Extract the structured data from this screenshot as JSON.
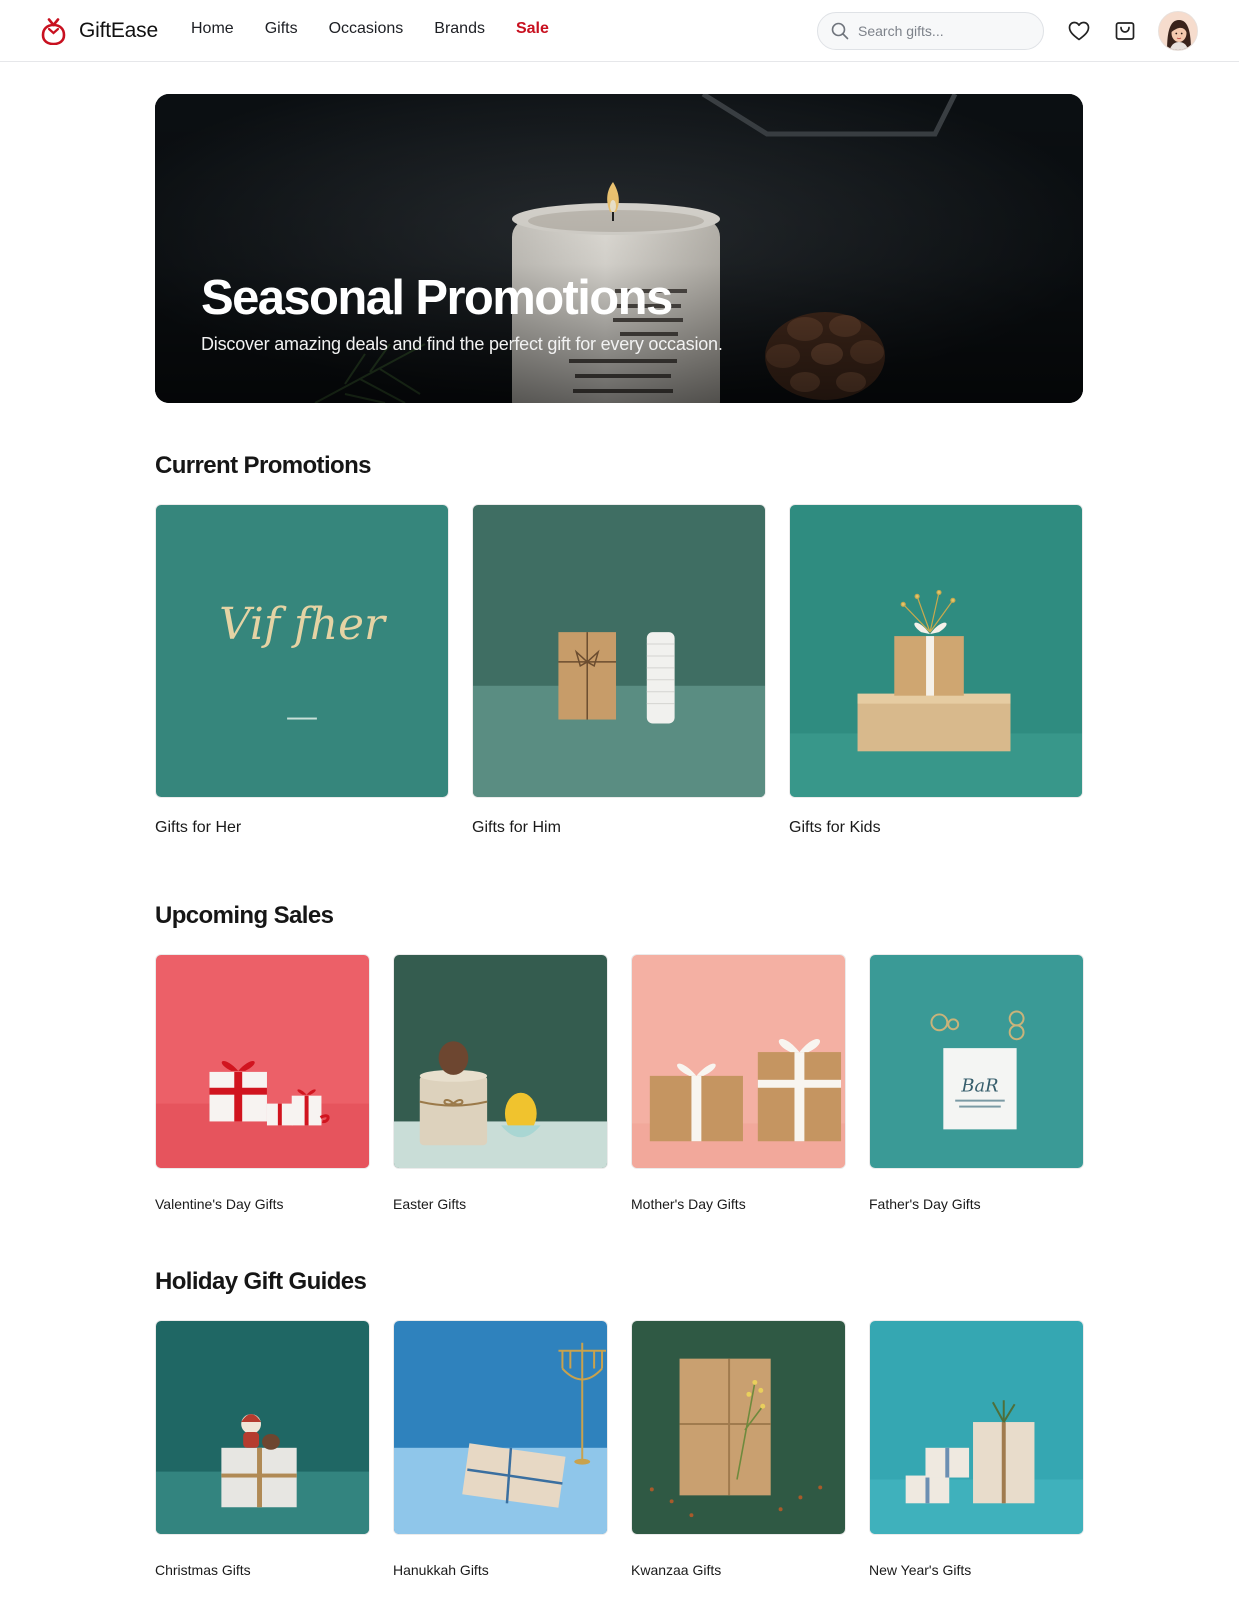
{
  "brand": {
    "name": "GiftEase",
    "logo_icon": "gift-pouch-icon",
    "accent": "#c8101f"
  },
  "nav": {
    "items": [
      {
        "label": "Home"
      },
      {
        "label": "Gifts"
      },
      {
        "label": "Occasions"
      },
      {
        "label": "Brands"
      },
      {
        "label": "Sale",
        "highlight": true
      }
    ]
  },
  "search": {
    "placeholder": "Search gifts...",
    "value": "",
    "icon": "search-icon"
  },
  "header_actions": {
    "wishlist_icon": "heart-icon",
    "cart_icon": "cart-icon",
    "avatar": "user-avatar"
  },
  "hero": {
    "title": "Seasonal Promotions",
    "subtitle": "Discover amazing deals and find the perfect gift for every occasion."
  },
  "sections": {
    "current_promotions": {
      "title": "Current Promotions",
      "cards": [
        {
          "label": "Gifts for Her",
          "image_text": "Vif fher"
        },
        {
          "label": "Gifts for Him"
        },
        {
          "label": "Gifts for Kids"
        }
      ]
    },
    "upcoming_sales": {
      "title": "Upcoming Sales",
      "cards": [
        {
          "label": "Valentine's Day Gifts"
        },
        {
          "label": "Easter Gifts"
        },
        {
          "label": "Mother's Day Gifts"
        },
        {
          "label": "Father's Day Gifts",
          "image_text": "BaR"
        }
      ]
    },
    "holiday_gift_guides": {
      "title": "Holiday Gift Guides",
      "cards": [
        {
          "label": "Christmas Gifts"
        },
        {
          "label": "Hanukkah Gifts"
        },
        {
          "label": "Kwanzaa Gifts"
        },
        {
          "label": "New Year's Gifts"
        }
      ]
    }
  }
}
